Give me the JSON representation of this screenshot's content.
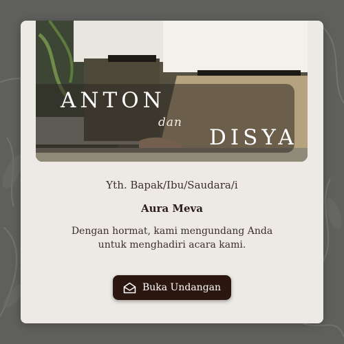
{
  "cover": {
    "name_left": "ANTON",
    "connector": "dan",
    "name_right": "DISYA"
  },
  "invite": {
    "greeting": "Yth. Bapak/Ibu/Saudara/i",
    "guest_name": "Aura Meva",
    "message": "Dengan hormat, kami mengundang Anda untuk menghadiri acara kami."
  },
  "actions": {
    "open_label": "Buka Undangan",
    "open_icon": "envelope-open-icon"
  },
  "colors": {
    "page_background": "#5f5f5d",
    "card_background": "#edeae6",
    "button_background": "#2c1610",
    "text_primary": "#3a2e26"
  }
}
